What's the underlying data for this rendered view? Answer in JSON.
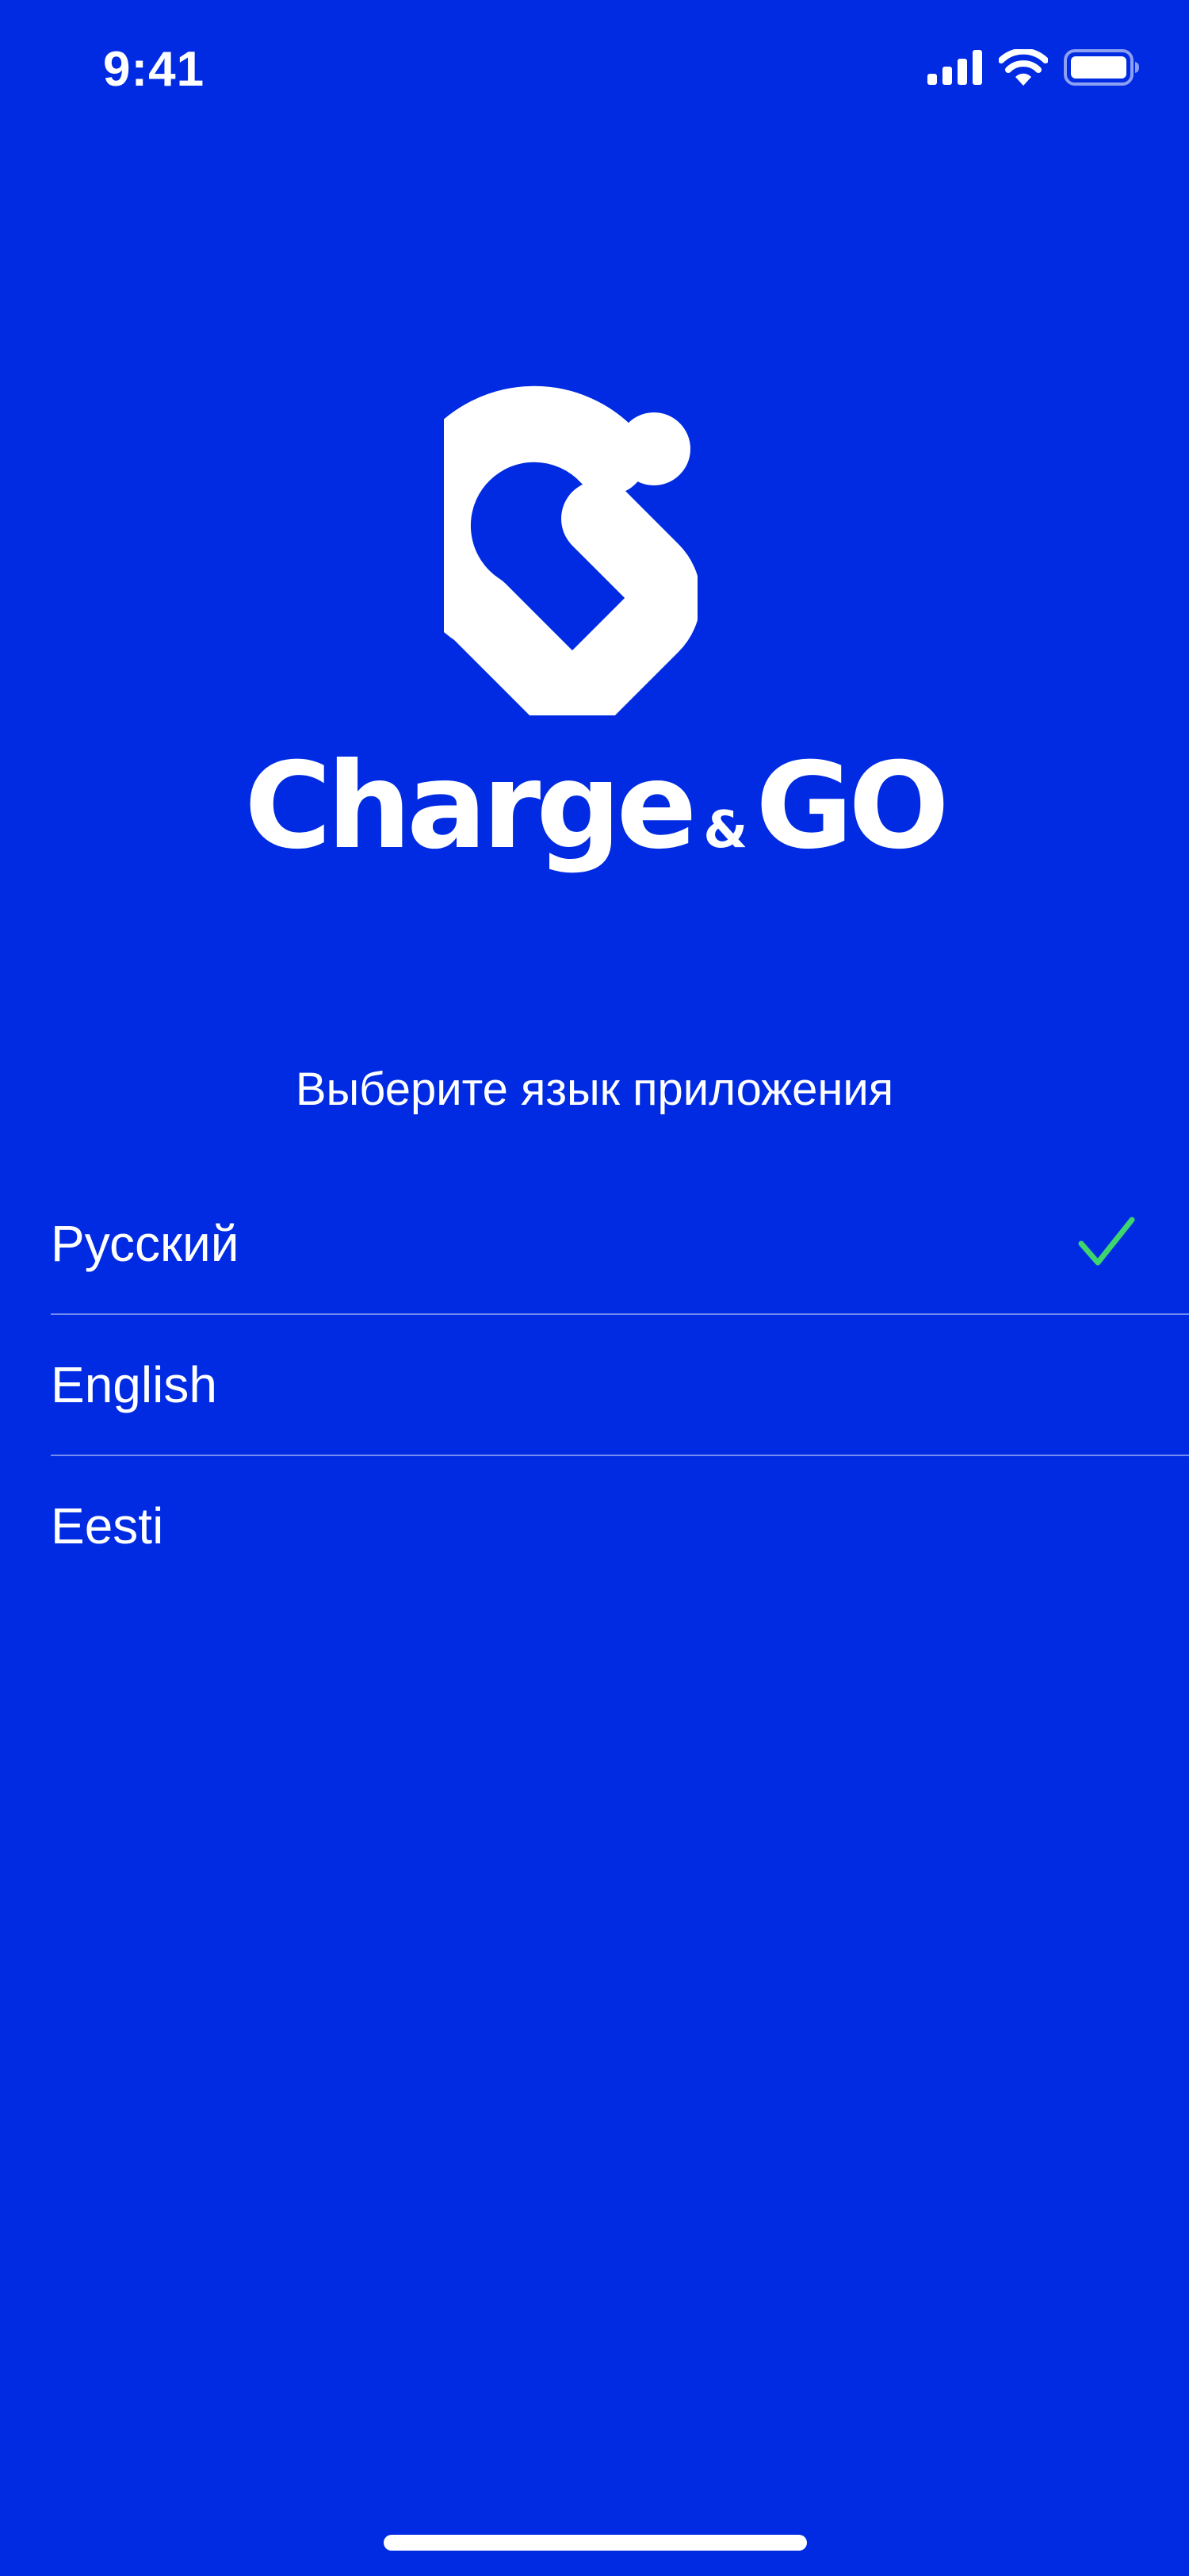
{
  "status_bar": {
    "time": "9:41"
  },
  "brand": {
    "word1": "Charge",
    "amp": "&",
    "word2": "GO"
  },
  "language_screen": {
    "prompt": "Выберите язык приложения",
    "options": [
      {
        "label": "Русский",
        "selected": true
      },
      {
        "label": "English",
        "selected": false
      },
      {
        "label": "Eesti",
        "selected": false
      }
    ]
  },
  "colors": {
    "background": "#002BE2",
    "text": "#FFFFFF",
    "check": "#3FD56E"
  },
  "icons": {
    "status": [
      "cellular-signal-icon",
      "wifi-icon",
      "battery-icon"
    ],
    "logo": "charge-and-go-logo",
    "selected_indicator": "checkmark-icon"
  }
}
